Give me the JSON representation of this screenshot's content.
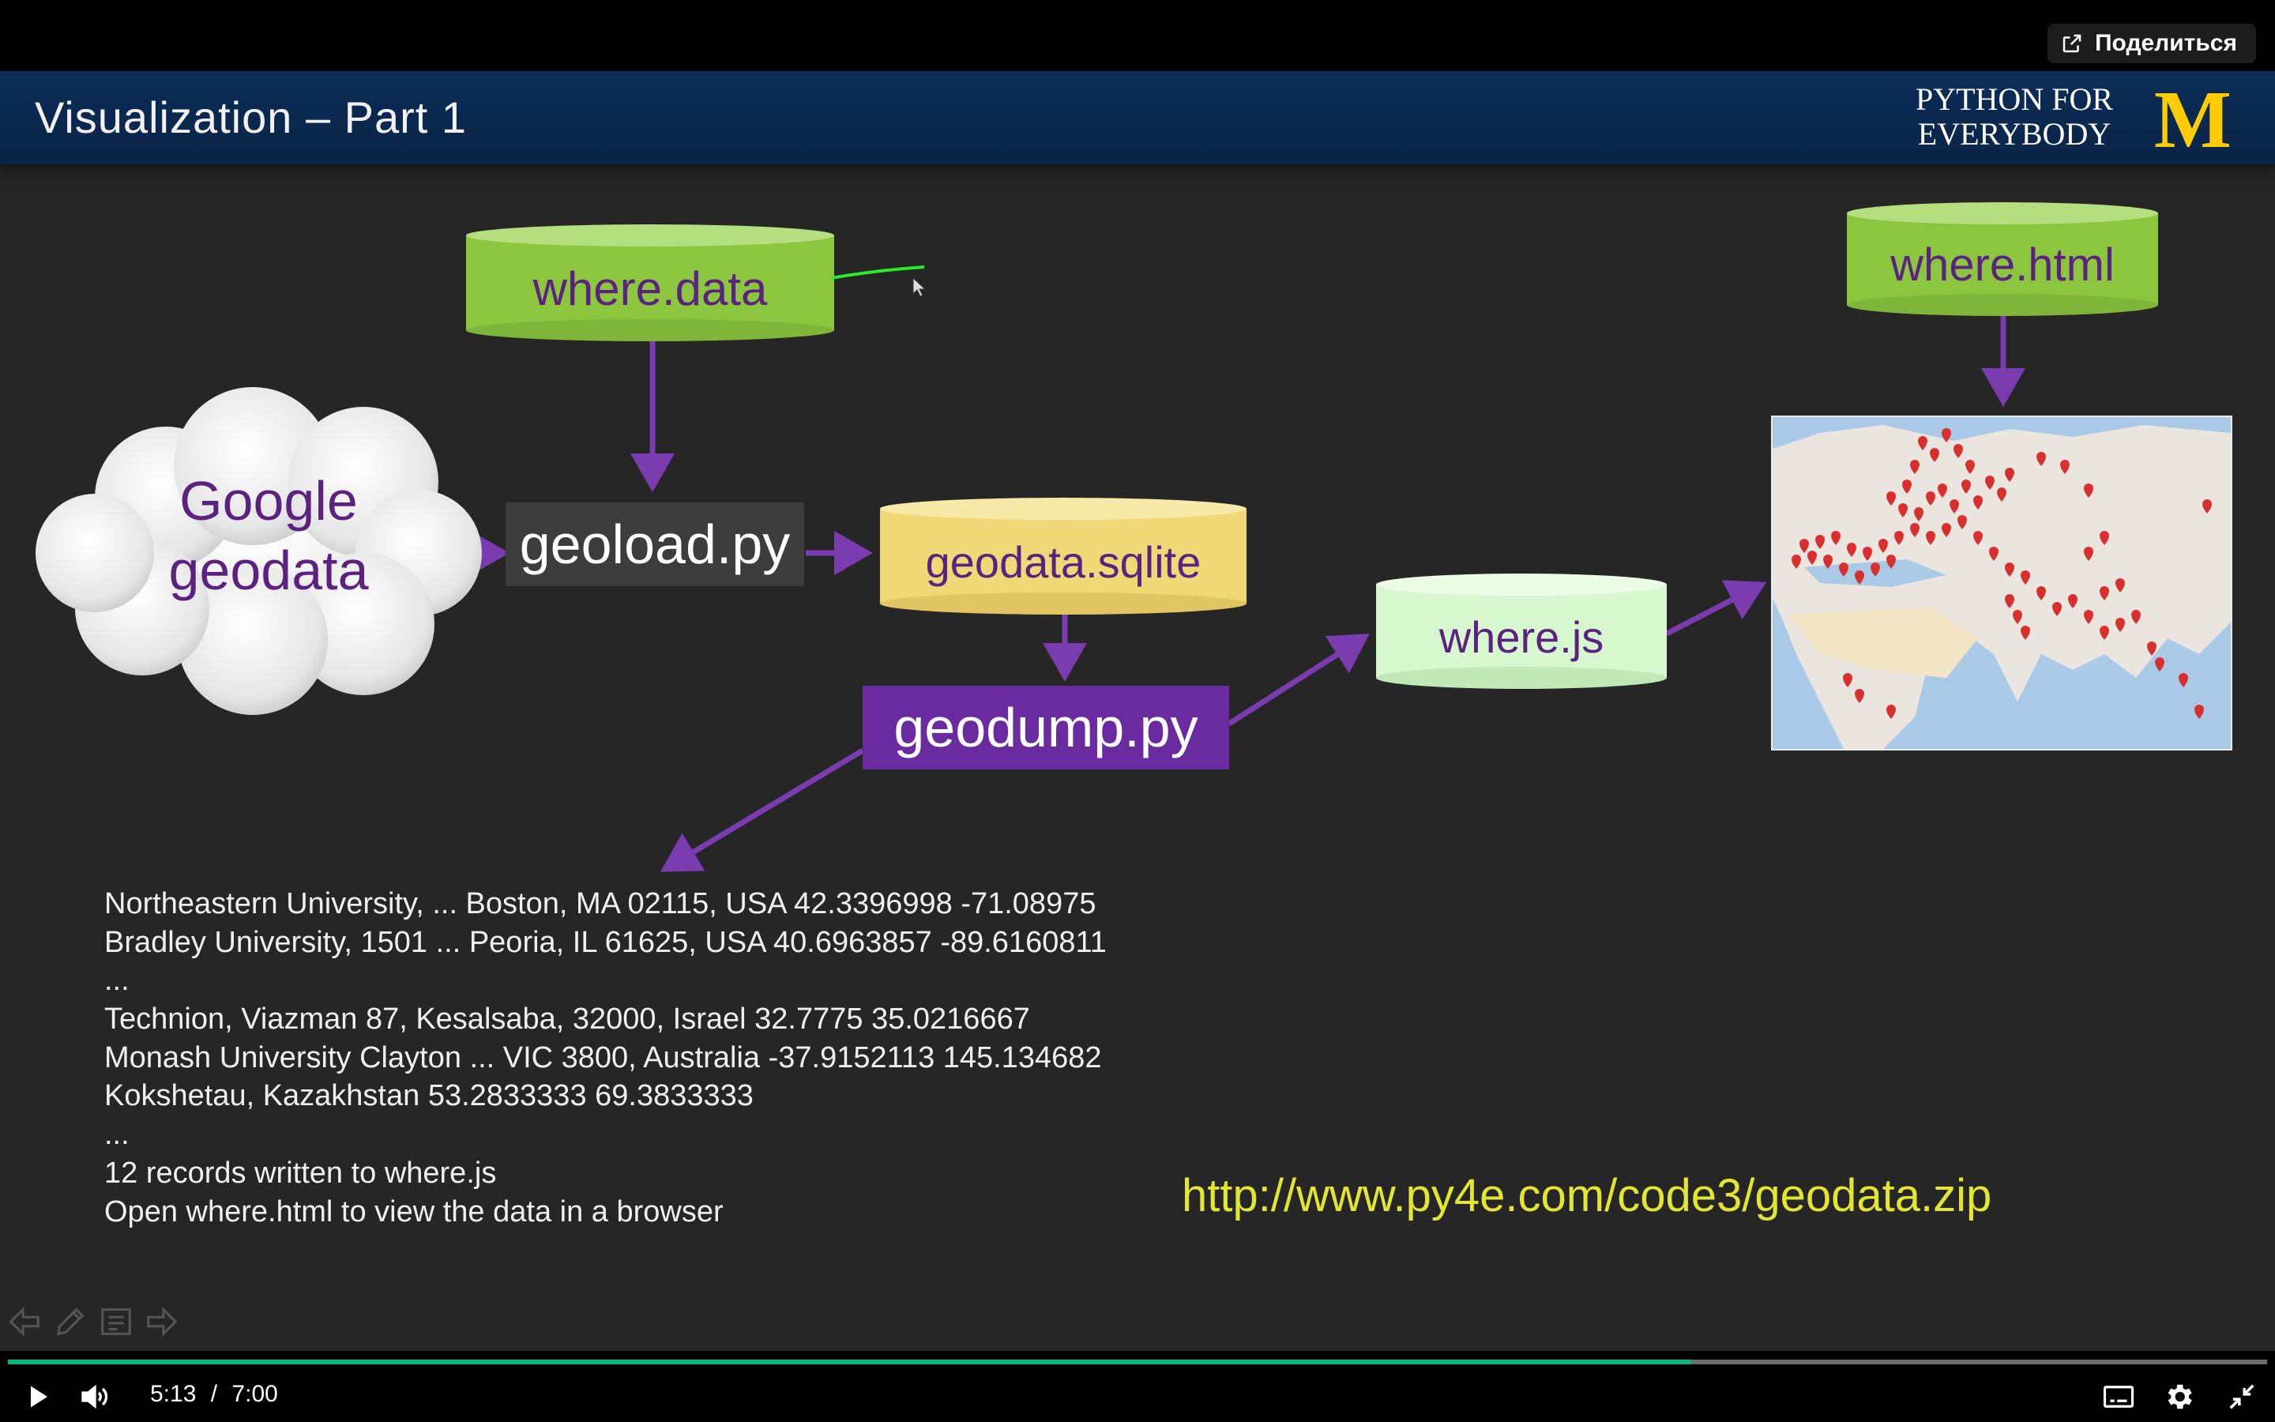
{
  "share_label": "Поделиться",
  "slide": {
    "title": "Visualization – Part 1",
    "brand_line1": "PYTHON FOR",
    "brand_line2": "EVERYBODY",
    "logo_letter": "M"
  },
  "diagram": {
    "where_data": "where.data",
    "where_html": "where.html",
    "cloud_line1": "Google",
    "cloud_line2": "geodata",
    "geoload": "geoload.py",
    "geodata_sqlite": "geodata.sqlite",
    "geodump": "geodump.py",
    "where_js": "where.js"
  },
  "output_lines": [
    "Northeastern University, ... Boston, MA 02115, USA 42.3396998 -71.08975",
    "Bradley University, 1501 ... Peoria, IL 61625, USA 40.6963857 -89.6160811",
    "...",
    "Technion, Viazman 87, Kesalsaba, 32000, Israel 32.7775 35.0216667",
    "Monash University Clayton ... VIC 3800, Australia -37.9152113 145.134682",
    "Kokshetau, Kazakhstan 53.2833333 69.3833333",
    "...",
    "12 records written to where.js",
    "Open where.html to view the data in a browser"
  ],
  "url": "http://www.py4e.com/code3/geodata.zip",
  "player": {
    "current_time": "5:13",
    "separator": "/",
    "duration": "7:00",
    "progress_fraction": 0.745
  },
  "colors": {
    "green_cyl": "#8cc63f",
    "yellow_cyl": "#f1d877",
    "mint_cyl": "#d7f7cf",
    "purple": "#6a2aa0",
    "arrow": "#7a3cae",
    "progress": "#00b980",
    "url": "#e3e631"
  },
  "icons": [
    "share-icon",
    "prev-slide-icon",
    "pen-icon",
    "notes-icon",
    "next-slide-icon",
    "play-icon",
    "volume-icon",
    "captions-icon",
    "settings-icon",
    "exit-fullscreen-icon"
  ]
}
